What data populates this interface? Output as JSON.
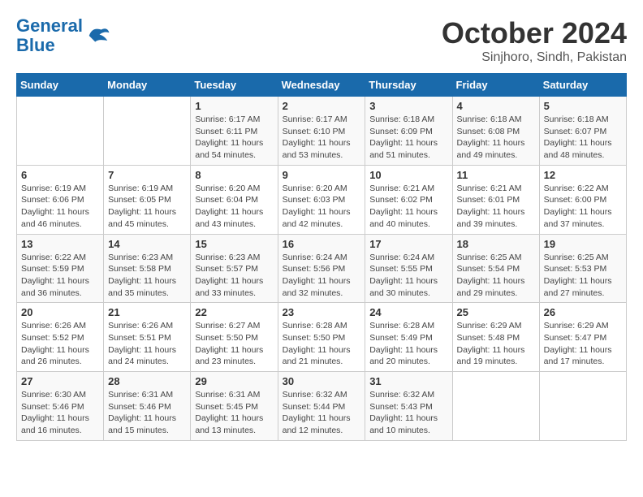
{
  "logo": {
    "line1": "General",
    "line2": "Blue"
  },
  "title": "October 2024",
  "location": "Sinjhoro, Sindh, Pakistan",
  "weekdays": [
    "Sunday",
    "Monday",
    "Tuesday",
    "Wednesday",
    "Thursday",
    "Friday",
    "Saturday"
  ],
  "weeks": [
    [
      {
        "day": "",
        "info": ""
      },
      {
        "day": "",
        "info": ""
      },
      {
        "day": "1",
        "info": "Sunrise: 6:17 AM\nSunset: 6:11 PM\nDaylight: 11 hours and 54 minutes."
      },
      {
        "day": "2",
        "info": "Sunrise: 6:17 AM\nSunset: 6:10 PM\nDaylight: 11 hours and 53 minutes."
      },
      {
        "day": "3",
        "info": "Sunrise: 6:18 AM\nSunset: 6:09 PM\nDaylight: 11 hours and 51 minutes."
      },
      {
        "day": "4",
        "info": "Sunrise: 6:18 AM\nSunset: 6:08 PM\nDaylight: 11 hours and 49 minutes."
      },
      {
        "day": "5",
        "info": "Sunrise: 6:18 AM\nSunset: 6:07 PM\nDaylight: 11 hours and 48 minutes."
      }
    ],
    [
      {
        "day": "6",
        "info": "Sunrise: 6:19 AM\nSunset: 6:06 PM\nDaylight: 11 hours and 46 minutes."
      },
      {
        "day": "7",
        "info": "Sunrise: 6:19 AM\nSunset: 6:05 PM\nDaylight: 11 hours and 45 minutes."
      },
      {
        "day": "8",
        "info": "Sunrise: 6:20 AM\nSunset: 6:04 PM\nDaylight: 11 hours and 43 minutes."
      },
      {
        "day": "9",
        "info": "Sunrise: 6:20 AM\nSunset: 6:03 PM\nDaylight: 11 hours and 42 minutes."
      },
      {
        "day": "10",
        "info": "Sunrise: 6:21 AM\nSunset: 6:02 PM\nDaylight: 11 hours and 40 minutes."
      },
      {
        "day": "11",
        "info": "Sunrise: 6:21 AM\nSunset: 6:01 PM\nDaylight: 11 hours and 39 minutes."
      },
      {
        "day": "12",
        "info": "Sunrise: 6:22 AM\nSunset: 6:00 PM\nDaylight: 11 hours and 37 minutes."
      }
    ],
    [
      {
        "day": "13",
        "info": "Sunrise: 6:22 AM\nSunset: 5:59 PM\nDaylight: 11 hours and 36 minutes."
      },
      {
        "day": "14",
        "info": "Sunrise: 6:23 AM\nSunset: 5:58 PM\nDaylight: 11 hours and 35 minutes."
      },
      {
        "day": "15",
        "info": "Sunrise: 6:23 AM\nSunset: 5:57 PM\nDaylight: 11 hours and 33 minutes."
      },
      {
        "day": "16",
        "info": "Sunrise: 6:24 AM\nSunset: 5:56 PM\nDaylight: 11 hours and 32 minutes."
      },
      {
        "day": "17",
        "info": "Sunrise: 6:24 AM\nSunset: 5:55 PM\nDaylight: 11 hours and 30 minutes."
      },
      {
        "day": "18",
        "info": "Sunrise: 6:25 AM\nSunset: 5:54 PM\nDaylight: 11 hours and 29 minutes."
      },
      {
        "day": "19",
        "info": "Sunrise: 6:25 AM\nSunset: 5:53 PM\nDaylight: 11 hours and 27 minutes."
      }
    ],
    [
      {
        "day": "20",
        "info": "Sunrise: 6:26 AM\nSunset: 5:52 PM\nDaylight: 11 hours and 26 minutes."
      },
      {
        "day": "21",
        "info": "Sunrise: 6:26 AM\nSunset: 5:51 PM\nDaylight: 11 hours and 24 minutes."
      },
      {
        "day": "22",
        "info": "Sunrise: 6:27 AM\nSunset: 5:50 PM\nDaylight: 11 hours and 23 minutes."
      },
      {
        "day": "23",
        "info": "Sunrise: 6:28 AM\nSunset: 5:50 PM\nDaylight: 11 hours and 21 minutes."
      },
      {
        "day": "24",
        "info": "Sunrise: 6:28 AM\nSunset: 5:49 PM\nDaylight: 11 hours and 20 minutes."
      },
      {
        "day": "25",
        "info": "Sunrise: 6:29 AM\nSunset: 5:48 PM\nDaylight: 11 hours and 19 minutes."
      },
      {
        "day": "26",
        "info": "Sunrise: 6:29 AM\nSunset: 5:47 PM\nDaylight: 11 hours and 17 minutes."
      }
    ],
    [
      {
        "day": "27",
        "info": "Sunrise: 6:30 AM\nSunset: 5:46 PM\nDaylight: 11 hours and 16 minutes."
      },
      {
        "day": "28",
        "info": "Sunrise: 6:31 AM\nSunset: 5:46 PM\nDaylight: 11 hours and 15 minutes."
      },
      {
        "day": "29",
        "info": "Sunrise: 6:31 AM\nSunset: 5:45 PM\nDaylight: 11 hours and 13 minutes."
      },
      {
        "day": "30",
        "info": "Sunrise: 6:32 AM\nSunset: 5:44 PM\nDaylight: 11 hours and 12 minutes."
      },
      {
        "day": "31",
        "info": "Sunrise: 6:32 AM\nSunset: 5:43 PM\nDaylight: 11 hours and 10 minutes."
      },
      {
        "day": "",
        "info": ""
      },
      {
        "day": "",
        "info": ""
      }
    ]
  ]
}
